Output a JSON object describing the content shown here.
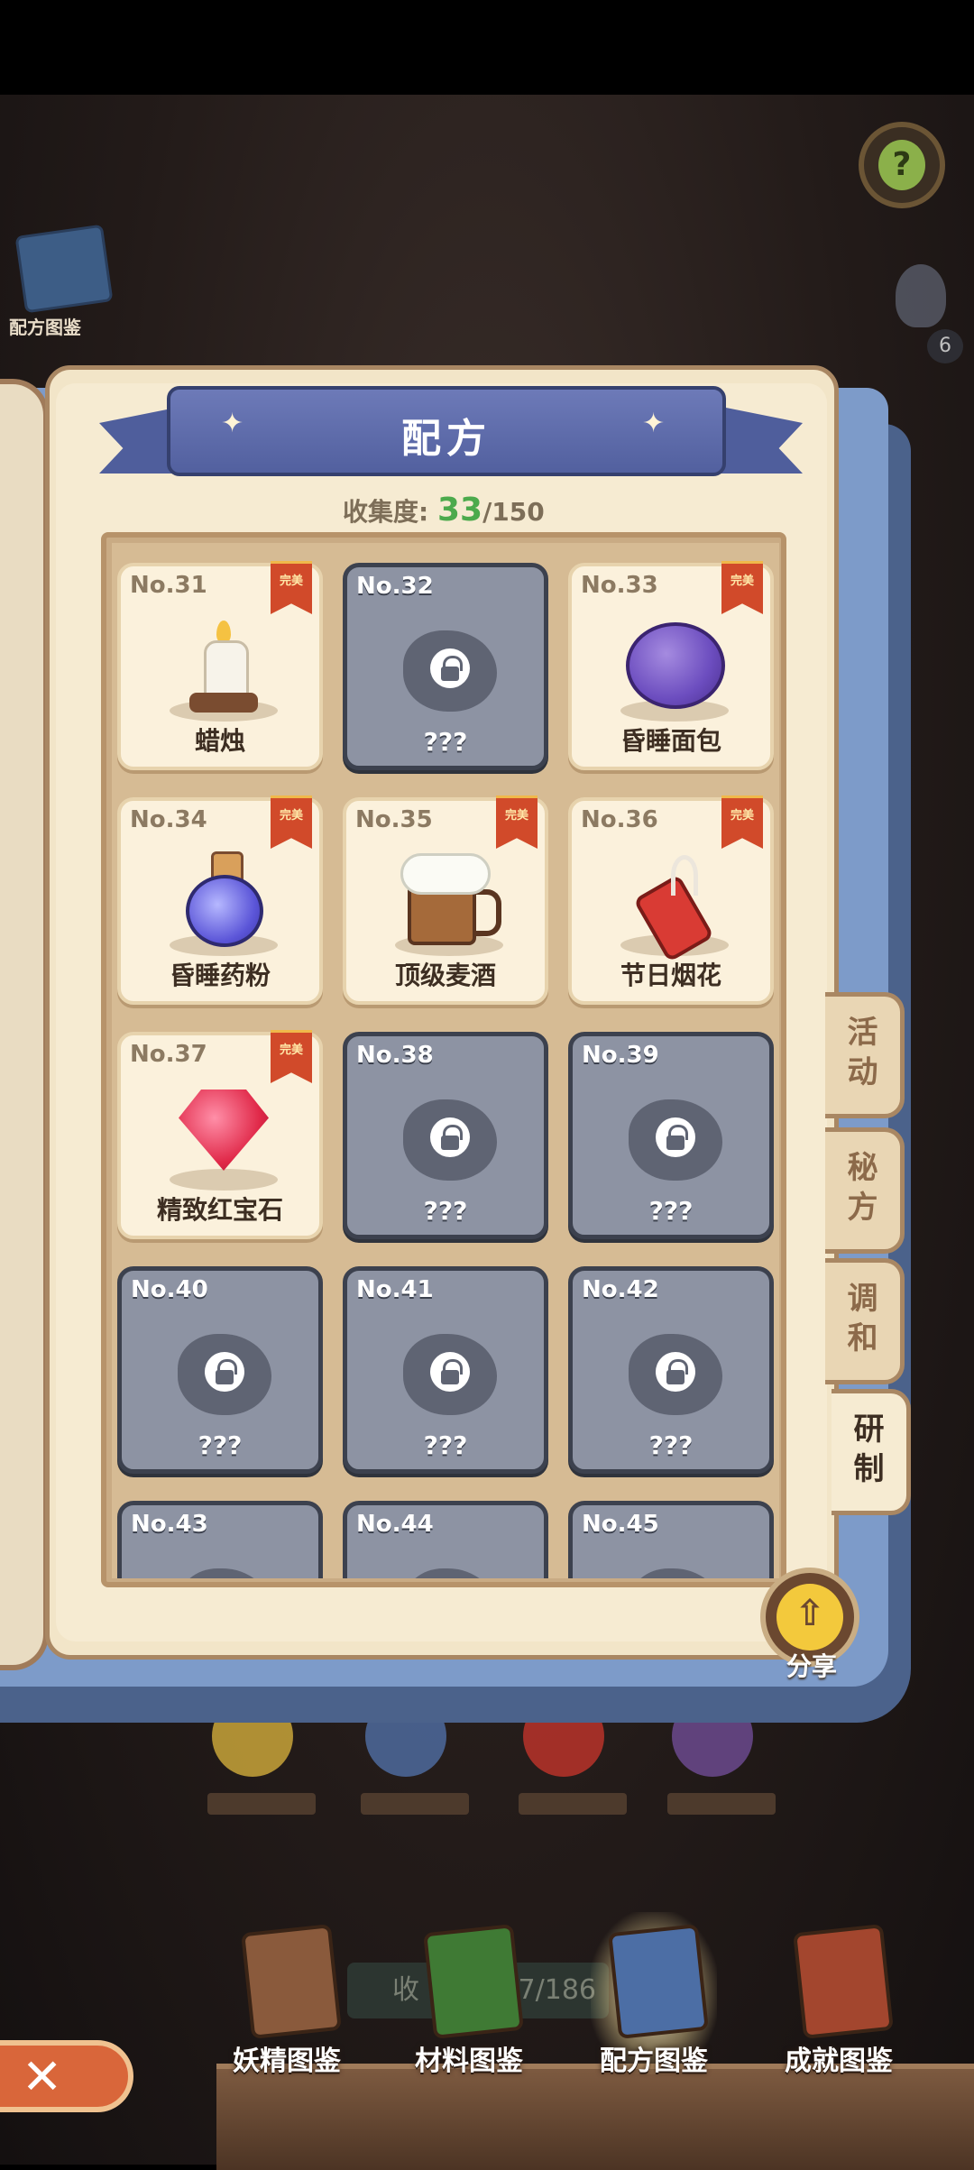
{
  "top_left_book": {
    "label": "配方图鉴"
  },
  "hint": {
    "count": "6"
  },
  "header": {
    "title": "配方"
  },
  "collection": {
    "label": "收集度:",
    "count": "33",
    "total": "/150"
  },
  "recipes": [
    {
      "no": "No.31",
      "name": "蜡烛",
      "status": "完美",
      "locked": false
    },
    {
      "no": "No.32",
      "name": "???",
      "locked": true
    },
    {
      "no": "No.33",
      "name": "昏睡面包",
      "status": "完美",
      "locked": false
    },
    {
      "no": "No.34",
      "name": "昏睡药粉",
      "status": "完美",
      "locked": false
    },
    {
      "no": "No.35",
      "name": "顶级麦酒",
      "status": "完美",
      "locked": false
    },
    {
      "no": "No.36",
      "name": "节日烟花",
      "status": "完美",
      "locked": false
    },
    {
      "no": "No.37",
      "name": "精致红宝石",
      "status": "完美",
      "locked": false
    },
    {
      "no": "No.38",
      "name": "???",
      "locked": true
    },
    {
      "no": "No.39",
      "name": "???",
      "locked": true
    },
    {
      "no": "No.40",
      "name": "???",
      "locked": true
    },
    {
      "no": "No.41",
      "name": "???",
      "locked": true
    },
    {
      "no": "No.42",
      "name": "???",
      "locked": true
    },
    {
      "no": "No.43",
      "name": "",
      "locked": true
    },
    {
      "no": "No.44",
      "name": "",
      "locked": true
    },
    {
      "no": "No.45",
      "name": "",
      "locked": true
    }
  ],
  "side_tabs": [
    "活动",
    "秘方",
    "调和",
    "研制"
  ],
  "share": {
    "label": "分享"
  },
  "bottom_nav": [
    {
      "label": "妖精图鉴",
      "color": "#8a5a3c"
    },
    {
      "label": "材料图鉴",
      "color": "#3f7a34"
    },
    {
      "label": "配方图鉴",
      "color": "#4c6ea5"
    },
    {
      "label": "成就图鉴",
      "color": "#a3462e"
    }
  ],
  "bg_collect_bar": {
    "text": "收",
    "count": "7/186"
  },
  "colors": {
    "accent_green": "#4caa4c",
    "ribbon": "#5d6bab",
    "perfect_badge": "#d14a2a"
  }
}
